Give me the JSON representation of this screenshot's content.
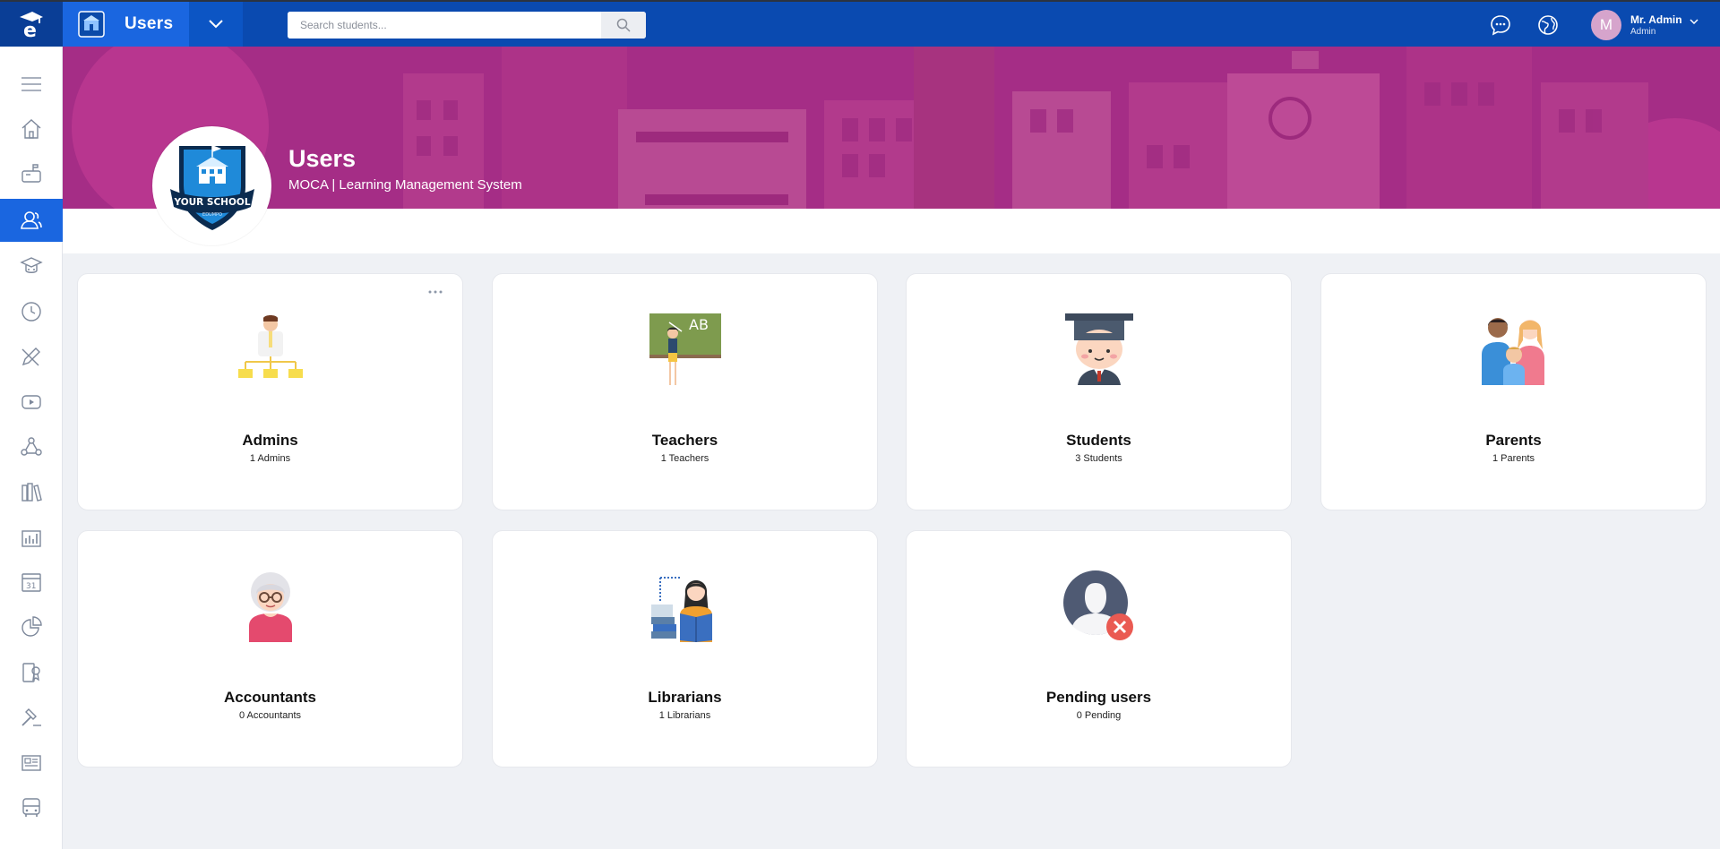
{
  "topbar": {
    "app_title": "Users",
    "search_placeholder": "Search students...",
    "user": {
      "initial": "M",
      "name": "Mr. Admin",
      "role": "Admin"
    }
  },
  "sidebar": {
    "items": [
      {
        "icon": "menu-icon"
      },
      {
        "icon": "home-icon"
      },
      {
        "icon": "mailbox-icon"
      },
      {
        "icon": "users-icon",
        "active": true
      },
      {
        "icon": "graduation-cap-icon"
      },
      {
        "icon": "clock-icon"
      },
      {
        "icon": "pencil-ruler-icon"
      },
      {
        "icon": "video-icon"
      },
      {
        "icon": "network-icon"
      },
      {
        "icon": "library-icon"
      },
      {
        "icon": "bar-chart-icon"
      },
      {
        "icon": "calendar-icon",
        "text": "31"
      },
      {
        "icon": "pie-chart-icon"
      },
      {
        "icon": "certificate-icon"
      },
      {
        "icon": "gavel-icon"
      },
      {
        "icon": "newspaper-icon"
      },
      {
        "icon": "bus-icon"
      }
    ]
  },
  "banner": {
    "title": "Users",
    "subtitle": "MOCA | Learning Management System",
    "logo_text": "YOUR SCHOOL",
    "logo_small_text": "EDUMPO"
  },
  "cards": [
    {
      "title": "Admins",
      "count": "1 Admins",
      "icon": "admin-hierarchy-icon"
    },
    {
      "title": "Teachers",
      "count": "1 Teachers",
      "icon": "teacher-blackboard-icon",
      "board_text": "AB"
    },
    {
      "title": "Students",
      "count": "3 Students",
      "icon": "graduate-student-icon"
    },
    {
      "title": "Parents",
      "count": "1 Parents",
      "icon": "family-icon"
    },
    {
      "title": "Accountants",
      "count": "0 Accountants",
      "icon": "accountant-icon"
    },
    {
      "title": "Librarians",
      "count": "1 Librarians",
      "icon": "librarian-icon"
    },
    {
      "title": "Pending users",
      "count": "0 Pending",
      "icon": "pending-user-icon"
    }
  ],
  "colors": {
    "topbar": "#0a4ab0",
    "accent": "#1a66e0",
    "banner": "#a52d86",
    "background": "#eff1f5"
  }
}
